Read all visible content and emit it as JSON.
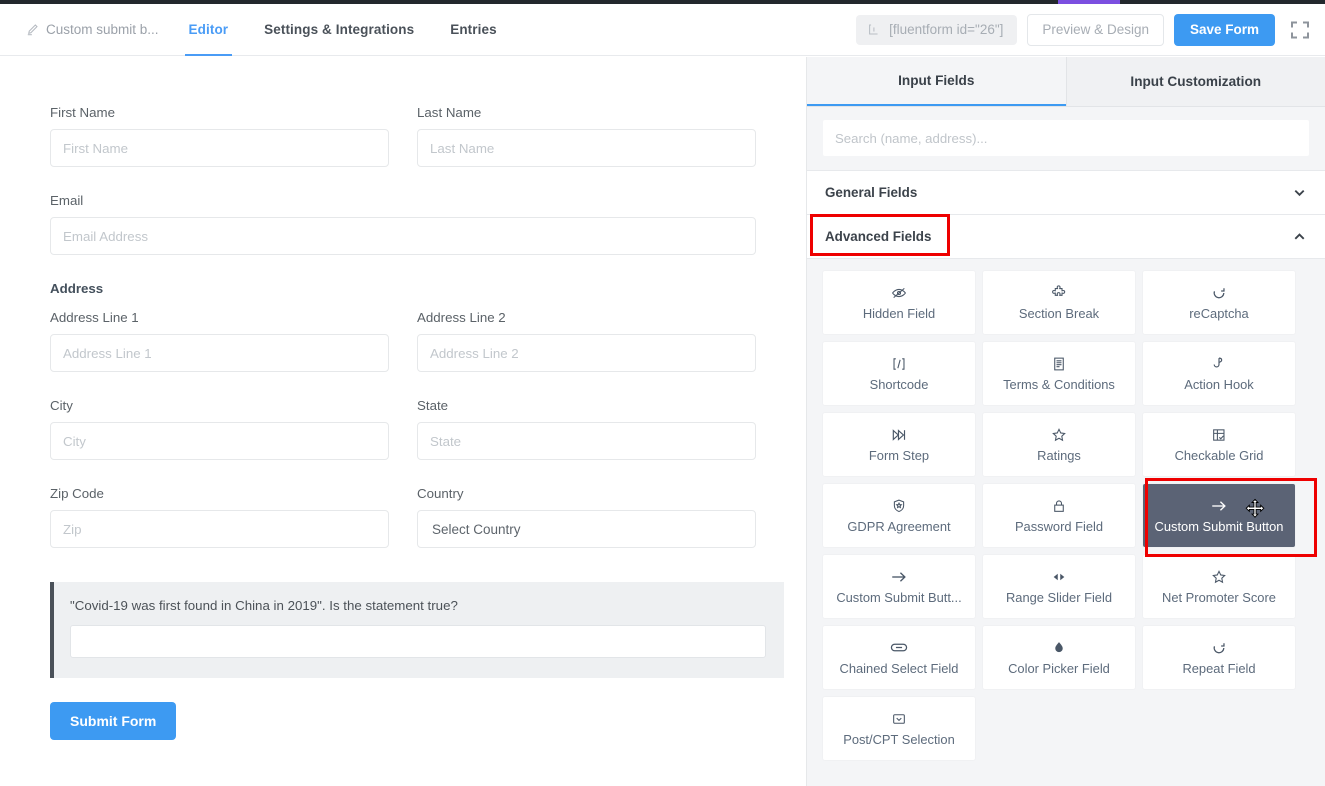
{
  "header": {
    "form_title": "Custom submit b...",
    "pencil_icon": "pencil-icon",
    "tabs": [
      {
        "label": "Editor",
        "active": true
      },
      {
        "label": "Settings & Integrations",
        "active": false
      },
      {
        "label": "Entries",
        "active": false
      }
    ],
    "shortcode": "[fluentform id=\"26\"]",
    "shortcode_icon": "shortcode-icon",
    "preview_label": "Preview & Design",
    "save_label": "Save Form",
    "fullscreen_icon": "fullscreen-icon",
    "accent_color": "#3d9af2",
    "loadbar_color": "#7b4fe0",
    "loadbar_bg": "#23282d"
  },
  "form": {
    "fields": {
      "first_name": {
        "label": "First Name",
        "placeholder": "First Name",
        "value": ""
      },
      "last_name": {
        "label": "Last Name",
        "placeholder": "Last Name",
        "value": ""
      },
      "email": {
        "label": "Email",
        "placeholder": "Email Address",
        "value": ""
      },
      "address_section": "Address",
      "address_line_1": {
        "label": "Address Line 1",
        "placeholder": "Address Line 1",
        "value": ""
      },
      "address_line_2": {
        "label": "Address Line 2",
        "placeholder": "Address Line 2",
        "value": ""
      },
      "city": {
        "label": "City",
        "placeholder": "City",
        "value": ""
      },
      "state": {
        "label": "State",
        "placeholder": "State",
        "value": ""
      },
      "zip": {
        "label": "Zip Code",
        "placeholder": "Zip",
        "value": ""
      },
      "country": {
        "label": "Country",
        "selected": "Select Country"
      }
    },
    "question_block": {
      "question": "\"Covid-19 was first found in China in 2019\". Is the statement true?",
      "answer_value": "",
      "accent_bar_color": "#4a5159",
      "background": "#eef0f2"
    },
    "submit_label": "Submit Form"
  },
  "panel": {
    "tabs": [
      {
        "label": "Input Fields",
        "active": true
      },
      {
        "label": "Input Customization",
        "active": false
      }
    ],
    "search_placeholder": "Search (name, address)...",
    "search_value": "",
    "accordions": [
      {
        "label": "General Fields",
        "expanded": false,
        "chevron": "chevron-down-icon",
        "highlighted": false
      },
      {
        "label": "Advanced Fields",
        "expanded": true,
        "chevron": "chevron-up-icon",
        "highlighted": true
      }
    ],
    "highlight_color": "#ee0000",
    "advanced_fields": [
      {
        "label": "Hidden Field",
        "icon": "eye-slash-icon",
        "dragging": false
      },
      {
        "label": "Section Break",
        "icon": "puzzle-piece-icon",
        "dragging": false
      },
      {
        "label": "reCaptcha",
        "icon": "recaptcha-icon",
        "dragging": false
      },
      {
        "label": "Shortcode",
        "icon": "shortcode-icon",
        "dragging": false
      },
      {
        "label": "Terms & Conditions",
        "icon": "document-icon",
        "dragging": false
      },
      {
        "label": "Action Hook",
        "icon": "hook-icon",
        "dragging": false
      },
      {
        "label": "Form Step",
        "icon": "forward-step-icon",
        "dragging": false
      },
      {
        "label": "Ratings",
        "icon": "star-icon",
        "dragging": false
      },
      {
        "label": "Checkable Grid",
        "icon": "grid-check-icon",
        "dragging": false
      },
      {
        "label": "GDPR Agreement",
        "icon": "shield-icon",
        "dragging": false
      },
      {
        "label": "Password Field",
        "icon": "lock-icon",
        "dragging": false
      },
      {
        "label": "Custom Submit Button",
        "icon": "arrow-right-icon",
        "dragging": true
      },
      {
        "label": "Custom Submit Butt...",
        "icon": "arrow-right-icon",
        "dragging": false
      },
      {
        "label": "Range Slider Field",
        "icon": "range-slider-icon",
        "dragging": false
      },
      {
        "label": "Net Promoter Score",
        "icon": "star-icon",
        "dragging": false
      },
      {
        "label": "Chained Select Field",
        "icon": "link-icon",
        "dragging": false
      },
      {
        "label": "Color Picker Field",
        "icon": "droplet-icon",
        "dragging": false
      },
      {
        "label": "Repeat Field",
        "icon": "repeat-icon",
        "dragging": false
      },
      {
        "label": "Post/CPT Selection",
        "icon": "dropdown-box-icon",
        "dragging": false
      }
    ],
    "cursor": "move-cursor"
  }
}
